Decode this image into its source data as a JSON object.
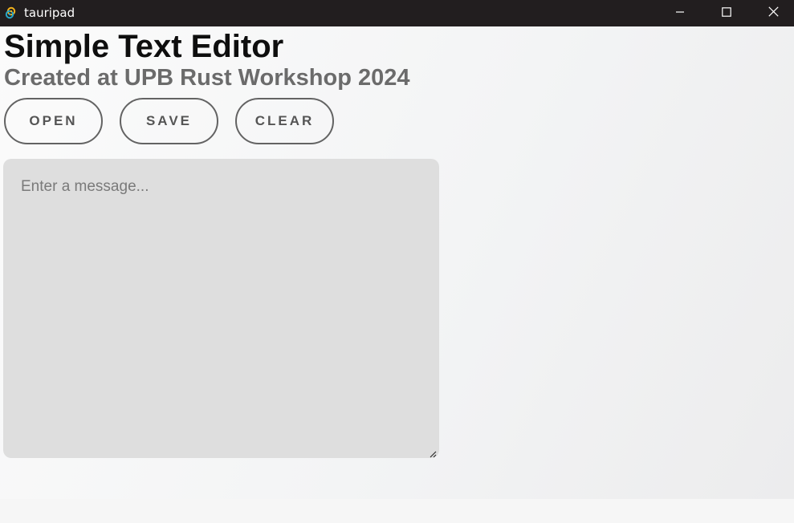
{
  "window": {
    "title": "tauripad",
    "icon": "tauri-logo-icon",
    "controls": {
      "minimize": "minimize-icon",
      "maximize": "maximize-icon",
      "close": "close-icon"
    }
  },
  "header": {
    "title": "Simple Text Editor",
    "subtitle": "Created at UPB Rust Workshop 2024"
  },
  "toolbar": {
    "open_label": "OPEN",
    "save_label": "SAVE",
    "clear_label": "CLEAR"
  },
  "editor": {
    "placeholder": "Enter a message...",
    "value": ""
  },
  "colors": {
    "titlebar_bg": "#221e1f",
    "editor_bg": "#dedede",
    "button_border": "#636363",
    "subtitle": "#6b6b6b"
  }
}
